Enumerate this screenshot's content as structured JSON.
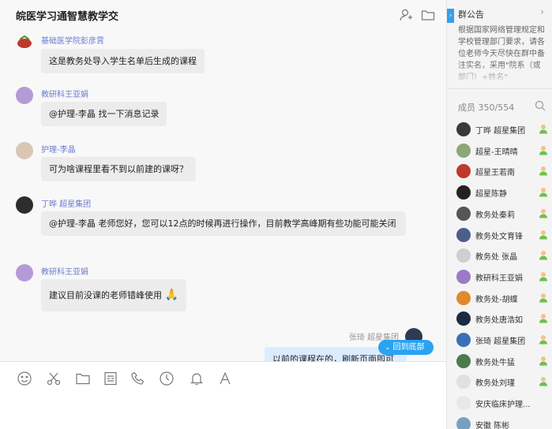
{
  "chat": {
    "title": "皖医学习通智慧教学交",
    "messages": [
      {
        "sender": "基础医学院彭彦霄",
        "text": "这是教务处导入学生名单后生成的课程"
      },
      {
        "sender": "教研科王亚娟",
        "text": "@护理-李晶 找一下消息记录"
      },
      {
        "sender": "护理-李晶",
        "text": "可为啥课程里看不到以前建的课呀？"
      },
      {
        "sender": "丁晔 超星集团",
        "text": "@护理-李晶 老师您好，您可以12点的时候再进行操作，目前教学高峰期有些功能可能关闭"
      },
      {
        "sender": "教研科王亚娟",
        "text": "建议目前没课的老师错峰使用",
        "emoji": "🙏"
      }
    ],
    "self_message": {
      "sender": "张琦 超星集团",
      "text": "以前的课程在的，刷新页面即可"
    },
    "back_to_bottom": "回到底部"
  },
  "toolbar": {
    "icons": [
      "emoji-icon",
      "scissors-icon",
      "folder-icon",
      "document-icon",
      "phone-icon",
      "clock-icon",
      "bell-icon",
      "font-icon"
    ]
  },
  "notice": {
    "title": "群公告",
    "body": "根据国家网络管理规定和学校管理部门要求，请各位老师今天尽快在群中备注实名，采用\"院系（或部门）+姓名\""
  },
  "members": {
    "title": "成员 350/554",
    "list": [
      {
        "name": "丁晔 超星集团",
        "color": "#3a3a3a"
      },
      {
        "name": "超星-王晴晴",
        "color": "#8aa878"
      },
      {
        "name": "超星王若南",
        "color": "#c0392b"
      },
      {
        "name": "超星陈静",
        "color": "#222222"
      },
      {
        "name": "教务处秦莉",
        "color": "#555555"
      },
      {
        "name": "教务处文育锋",
        "color": "#4a5f8a"
      },
      {
        "name": "教务处 张晶",
        "color": "#cfcfcf"
      },
      {
        "name": "教研科王亚娟",
        "color": "#9b7ac7"
      },
      {
        "name": "教务处-胡蝶",
        "color": "#e08a2e"
      },
      {
        "name": "教务处唐浩如",
        "color": "#1e2a40"
      },
      {
        "name": "张琦 超星集团",
        "color": "#3b6fb8"
      },
      {
        "name": "教务处牛猛",
        "color": "#4d7a4d"
      },
      {
        "name": "教务处刘瑾",
        "color": "#e0e0e0"
      },
      {
        "name": "安庆临床护理...",
        "color": "#e8e8e8"
      },
      {
        "name": "安徽 陈彬",
        "color": "#7aa0c0"
      }
    ]
  },
  "colors": {
    "accent": "#29a3f2",
    "sender": "#6b7bd0",
    "badge": "#6cc24a"
  }
}
